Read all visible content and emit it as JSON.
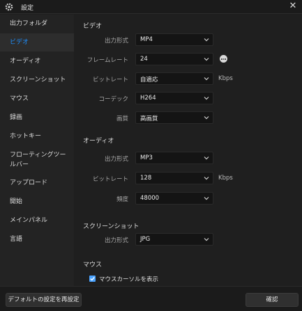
{
  "window": {
    "title": "設定",
    "icon": "gear-icon",
    "close_icon": "close-icon"
  },
  "sidebar": {
    "items": [
      {
        "label": "出力フォルダ"
      },
      {
        "label": "ビデオ",
        "active": true
      },
      {
        "label": "オーディオ"
      },
      {
        "label": "スクリーンショット"
      },
      {
        "label": "マウス"
      },
      {
        "label": "録画"
      },
      {
        "label": "ホットキー"
      },
      {
        "label": "フローティングツールバー"
      },
      {
        "label": "アップロード"
      },
      {
        "label": "開始"
      },
      {
        "label": "メインパネル"
      },
      {
        "label": "言語"
      }
    ]
  },
  "video": {
    "title": "ビデオ",
    "format_label": "出力形式",
    "format_value": "MP4",
    "framerate_label": "フレームレート",
    "framerate_value": "24",
    "bitrate_label": "ビットレート",
    "bitrate_value": "自適応",
    "bitrate_unit": "Kbps",
    "codec_label": "コーデック",
    "codec_value": "H264",
    "quality_label": "画質",
    "quality_value": "高画質"
  },
  "audio": {
    "title": "オーディオ",
    "format_label": "出力形式",
    "format_value": "MP3",
    "bitrate_label": "ビットレート",
    "bitrate_value": "128",
    "bitrate_unit": "Kbps",
    "frequency_label": "頻度",
    "frequency_value": "48000"
  },
  "screenshot": {
    "title": "スクリーンショット",
    "format_label": "出力形式",
    "format_value": "JPG"
  },
  "mouse": {
    "title": "マウス",
    "show_cursor_label": "マウスカーソルを表示",
    "show_cursor_checked": true
  },
  "footer": {
    "reset_label": "デフォルトの設定を再設定",
    "confirm_label": "確認"
  },
  "colors": {
    "accent": "#1e90ff",
    "checkbox": "#4aa3ff",
    "background": "#1f1f1f",
    "sidebar": "#232323"
  }
}
